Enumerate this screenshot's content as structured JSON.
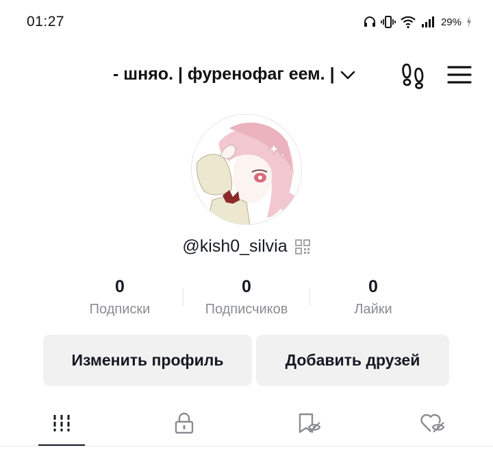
{
  "status_bar": {
    "time": "01:27",
    "battery": "29%",
    "icons": [
      "headphones-icon",
      "vibrate-icon",
      "wifi-icon",
      "signal-icon",
      "battery-charging-icon"
    ]
  },
  "header": {
    "account_name": "- шняо. | фуренофаг еем. |",
    "icons": [
      "chevron-down-icon",
      "footprints-icon",
      "menu-icon"
    ]
  },
  "profile": {
    "username": "@kish0_silvia"
  },
  "stats": [
    {
      "value": "0",
      "label": "Подписки"
    },
    {
      "value": "0",
      "label": "Подписчиков"
    },
    {
      "value": "0",
      "label": "Лайки"
    }
  ],
  "buttons": {
    "edit_profile": "Изменить профиль",
    "add_friends": "Добавить друзей"
  },
  "tabs": [
    "grid-icon",
    "lock-icon",
    "bookmark-hidden-icon",
    "liked-hidden-icon"
  ],
  "colors": {
    "text": "#161823",
    "muted": "#8a8b91",
    "button_bg": "#f1f1f2"
  }
}
